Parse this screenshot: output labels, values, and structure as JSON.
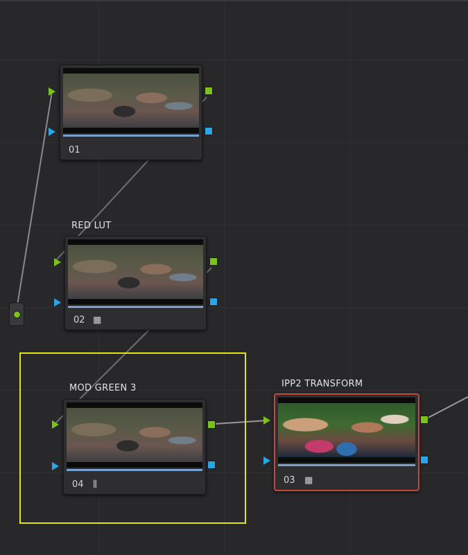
{
  "nodes": {
    "n01": {
      "number": "01",
      "label": ""
    },
    "n02": {
      "number": "02",
      "label": "RED LUT",
      "badge_icon": "lut-grid-icon"
    },
    "n04": {
      "number": "04",
      "label": "MOD GREEN 3",
      "badge_icon": "curves-sliders-icon"
    },
    "n03": {
      "number": "03",
      "label": "IPP2 TRANSFORM",
      "badge_icon": "lut-grid-icon"
    }
  },
  "colors": {
    "background": "#28282b",
    "rgb_port": "#7bc21c",
    "alpha_port": "#2aa6e6",
    "selection_highlight": "#e6e21c",
    "current_node_border": "#c5483b"
  },
  "glyphs": {
    "lut_grid": "▦",
    "sliders": "⫼"
  }
}
